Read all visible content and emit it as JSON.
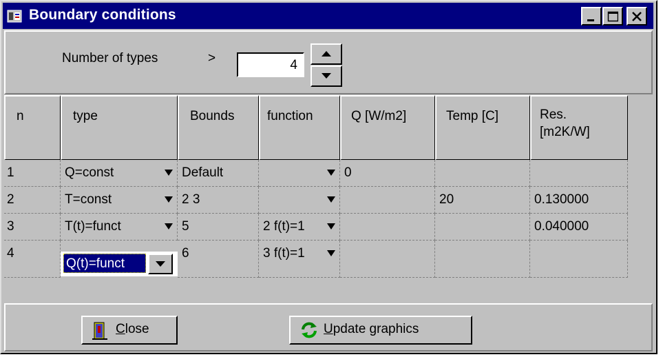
{
  "window": {
    "title": "Boundary conditions",
    "title_icon": "app-icon",
    "controls": [
      "minimize-icon",
      "maximize-icon",
      "close-icon"
    ]
  },
  "types_control": {
    "label": "Number of types",
    "arrow": ">",
    "value": "4"
  },
  "grid": {
    "headers": {
      "n": "n",
      "type": "type",
      "bounds": "Bounds",
      "function": "function",
      "q": "Q [W/m2]",
      "temp": "Temp  [C]",
      "res_line1": "Res.",
      "res_line2": "[m2K/W]"
    },
    "rows": [
      {
        "n": "1",
        "type": "Q=const",
        "bounds": "Default",
        "function": "",
        "q": "0",
        "temp": "",
        "res": ""
      },
      {
        "n": "2",
        "type": "T=const",
        "bounds": "2 3",
        "function": "",
        "q": "",
        "temp": "20",
        "res": "0.130000"
      },
      {
        "n": "3",
        "type": "T(t)=funct",
        "bounds": "5",
        "function": "2 f(t)=1",
        "q": "",
        "temp": "",
        "res": "0.040000"
      },
      {
        "n": "4",
        "type": "Q(t)=funct",
        "bounds": "6",
        "function": "3 f(t)=1",
        "q": "",
        "temp": "",
        "res": ""
      }
    ]
  },
  "buttons": {
    "close_first": "C",
    "close_rest": "lose",
    "update_first": "U",
    "update_rest": "pdate graphics"
  },
  "colors": {
    "titlebar": "#000080",
    "face": "#c0c0c0",
    "selection": "#000080"
  }
}
